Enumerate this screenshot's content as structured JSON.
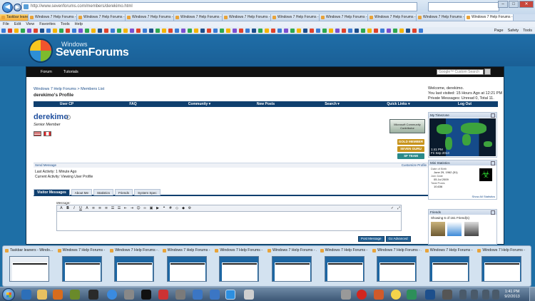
{
  "browser": {
    "url": "http://www.sevenforums.com/members/derekimo.html",
    "tabs": [
      "Taskbar leaners - Windo...",
      "Windows 7 Help Forums - Vi...",
      "Windows 7 Help Forums - Vi...",
      "Windows 7 Help Forums - Vi...",
      "Windows 7 Help Forums - Vi...",
      "Windows 7 Help Forums - Vi...",
      "Windows 7 Help Forums - Vi...",
      "Windows 7 Help Forums - Vi...",
      "Windows 7 Help Forums - Vi...",
      "Windows 7 Help Forums - Vi...",
      "Windows 7 Help Forums - Vi..."
    ],
    "menu": [
      "File",
      "Edit",
      "View",
      "Favorites",
      "Tools",
      "Help"
    ],
    "commands": [
      "Page",
      "Safety",
      "Tools"
    ],
    "favorites_colors": [
      "#3a7bd5",
      "#e0432b",
      "#f5b400",
      "#2fa84f",
      "#7b4fd0",
      "#e0432b",
      "#1d4f8c",
      "#3a7bd5",
      "#f5b400",
      "#2fa84f",
      "#e0432b",
      "#3a7bd5",
      "#7b4fd0",
      "#2fa84f",
      "#f5b400",
      "#1d4f8c",
      "#e0432b",
      "#3a7bd5",
      "#2fa84f",
      "#f5b400",
      "#7b4fd0",
      "#e0432b",
      "#3a7bd5",
      "#1d4f8c",
      "#2fa84f",
      "#f5b400",
      "#e0432b",
      "#3a7bd5",
      "#7b4fd0",
      "#2fa84f",
      "#f5b400",
      "#1d4f8c",
      "#e0432b",
      "#3a7bd5",
      "#2fa84f",
      "#f5b400",
      "#7b4fd0",
      "#e0432b",
      "#3a7bd5",
      "#1d4f8c",
      "#2fa84f",
      "#f5b400",
      "#e0432b",
      "#3a7bd5",
      "#7b4fd0",
      "#2fa84f",
      "#f5b400",
      "#1d4f8c",
      "#e0432b",
      "#3a7bd5",
      "#2fa84f",
      "#f5b400",
      "#7b4fd0",
      "#e0432b",
      "#3a7bd5",
      "#1d4f8c",
      "#2fa84f",
      "#f5b400",
      "#e0432b",
      "#3a7bd5",
      "#7b4fd0",
      "#2fa84f",
      "#f5b400",
      "#1d4f8c",
      "#e0432b",
      "#3a7bd5",
      "#2fa84f",
      "#f5b400",
      "#7b4fd0",
      "#e0432b"
    ]
  },
  "site": {
    "logo_small": "Windows",
    "logo_big": "SevenForums",
    "nav": [
      "Forum",
      "Tutorials"
    ],
    "search_placeholder": "Google™ Custom Search"
  },
  "profile": {
    "breadcrumb": "Windows 7 Help Forums > Members List",
    "page_title": "derekimo's Profile",
    "welcome_name": "derekimo.",
    "welcome_lines": [
      "Welcome, derekimo.",
      "You last visited: 15 Hours Ago at 12:21 PM",
      "Private Messages: Unread 0, Total 11."
    ],
    "navrow": [
      "User CP",
      "FAQ",
      "Community ▾",
      "New Posts",
      "Search ▾",
      "Quick Links ▾",
      "Log Out"
    ],
    "username": "derekimo",
    "user_title": "Senior Member",
    "contributor_badge": "Microsoft Community Contributor",
    "badges": [
      "GOLD MEMBER",
      "SEVEN GURU",
      "SF TEAM"
    ],
    "send_message": "Send Message",
    "customize_profile": "Customize Profile",
    "last_activity": "Last Activity: 1 Minute Ago",
    "current_activity": "Current Activity: Viewing User Profile",
    "tabs": [
      "Visitor Messages",
      "About Me",
      "Statistics",
      "Friends",
      "System Spec"
    ],
    "message_label": "Message:",
    "post_buttons": [
      "Post Message",
      "Go Advanced"
    ]
  },
  "sidebar": {
    "timezone_title": "My Timezone",
    "map_time": "1:41 PM",
    "map_date": "Fri Sep 2013",
    "mini_stats_title": "Mini Statistics",
    "stats": [
      "Date of Birth",
      "June 29, 1962 (51)",
      "Join Date",
      "05 Jul 2009",
      "Total Posts",
      "10,636"
    ],
    "show_all": "Show All Statistics",
    "friends_title": "Friends",
    "friends_showing": "Showing 6 of 161 Friend(s)"
  },
  "thumbnails": [
    "Taskbar leaners - Windo...",
    "Windows 7 Help Forums - ...",
    "Windows 7 Help Forums - ...",
    "Windows 7 Help Forums - ...",
    "Windows 7 Help Forums - ...",
    "Windows 7 Help Forums - ...",
    "Windows 7 Help Forums - ...",
    "Windows 7 Help Forums - ...",
    "Windows 7 Help Forums - ...",
    "Windows 7 Help Forums - ..."
  ],
  "taskbar": {
    "time": "1:41 PM",
    "date": "9/2/2013"
  }
}
